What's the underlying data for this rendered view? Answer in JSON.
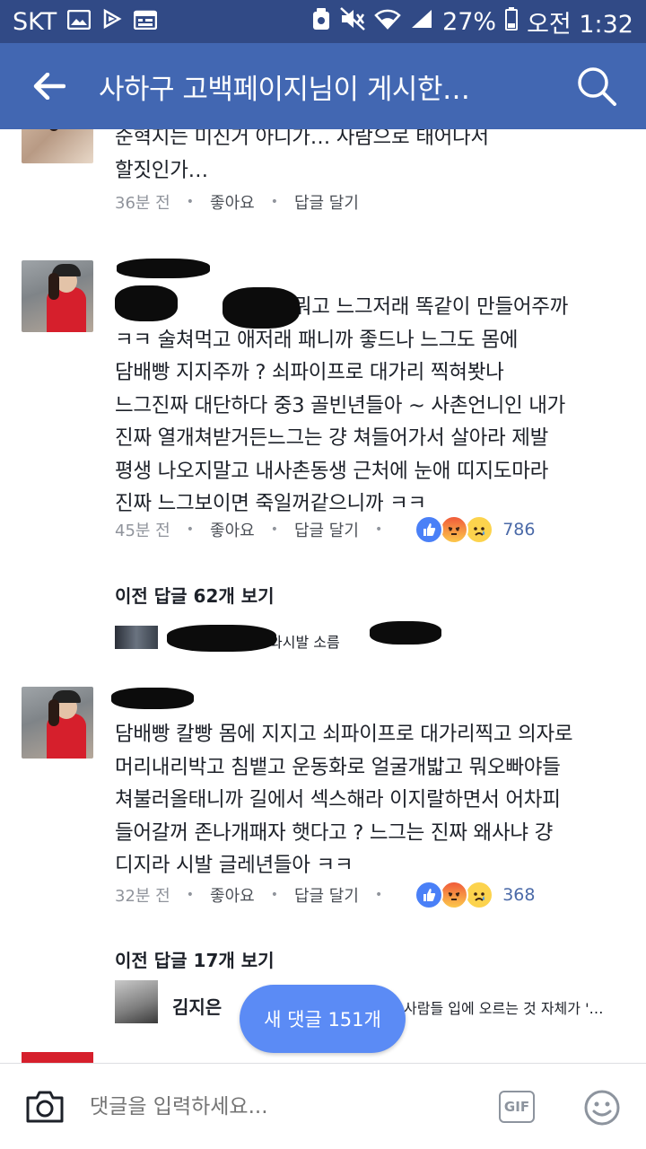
{
  "status_bar": {
    "carrier": "SKT",
    "battery": "27%",
    "time": "오전 1:32"
  },
  "app_bar": {
    "title": "사하구 고백페이지님이 게시한…"
  },
  "comments": [
    {
      "text_lines": [
        "순혁지는 미진거 아니가… 사람으로 태어나서",
        "할짓인가…"
      ],
      "time": "36분 전",
      "like_label": "좋아요",
      "reply_label": "답글 달기"
    },
    {
      "text_lines": [
        "이고 고 뭐고 느그저래 똑같이 만들어주까",
        "ㅋㅋ 술쳐먹고 애저래 패니까 좋드나 느그도 몸에",
        "담배빵 지지주까 ? 쇠파이프로 대가리 찍혀봣나",
        "느그진짜 대단하다 중3 골빈년들아 ~ 사촌언니인 내가",
        "진짜 열개쳐받거든느그는 걍 쳐들어가서 살아라 제발",
        "평생 나오지말고 내사촌동생 근처에 눈애 띠지도마라",
        "진짜 느그보이면 죽일꺼같으니까  ㅋㅋ"
      ],
      "time": "45분 전",
      "like_label": "좋아요",
      "reply_label": "답글 달기",
      "reaction_count": "786",
      "prev_replies": "이전 답글 62개 보기",
      "reply_preview": "와시발 소름"
    },
    {
      "text_lines": [
        "담배빵 칼빵 몸에 지지고 쇠파이프로 대가리찍고 의자로",
        "머리내리박고 침뱉고 운동화로 얼굴개밟고 뭐오빠야들",
        "쳐불러올태니까 길에서 섹스해라 이지랄하면서 어차피",
        "들어갈꺼 존나개패자 햇다고 ? 느그는 진짜 왜사냐 걍",
        "디지라 시발 글레년들아 ㅋㅋ"
      ],
      "time": "32분 전",
      "like_label": "좋아요",
      "reply_label": "답글 달기",
      "reaction_count": "368",
      "prev_replies": "이전 답글 17개 보기",
      "reply_preview_name": "김지은",
      "reply_preview": "사람들 입에 오르는 것 자체가 '…"
    }
  ],
  "new_comments_button": "새 댓글 151개",
  "composer": {
    "placeholder": "댓글을 입력하세요...",
    "gif_label": "GIF"
  },
  "colors": {
    "appbar": "#4267b2",
    "statusbar": "#314a86",
    "new_comments": "#5b8bf5"
  }
}
